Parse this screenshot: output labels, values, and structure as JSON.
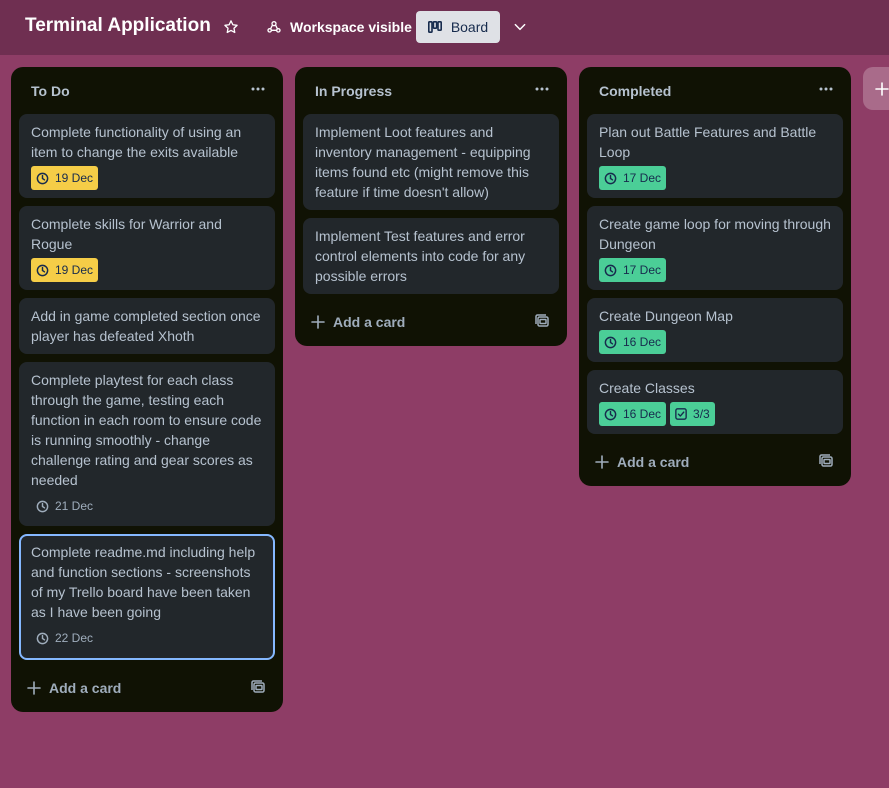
{
  "header": {
    "title": "Terminal Application",
    "visibility_label": "Workspace visible",
    "view_label": "Board"
  },
  "lists": [
    {
      "title": "To Do",
      "add_label": "Add a card",
      "cards": [
        {
          "text": "Complete functionality of using an item to change the exits available",
          "due": "19 Dec"
        },
        {
          "text": "Complete skills for Warrior and Rogue",
          "due": "19 Dec"
        },
        {
          "text": "Add in game completed section once player has defeated Xhoth"
        },
        {
          "text": "Complete playtest for each class through the game, testing each function in each room to ensure code is running smoothly - change challenge rating and gear scores as needed",
          "due": "21 Dec"
        },
        {
          "text": "Complete readme.md including help and function sections - screenshots of my Trello board have been taken as I have been going",
          "due": "22 Dec"
        }
      ]
    },
    {
      "title": "In Progress",
      "add_label": "Add a card",
      "cards": [
        {
          "text": "Implement Loot features and inventory management - equipping items found etc (might remove this feature if time doesn't allow)"
        },
        {
          "text": "Implement Test features and error control elements into code for any possible errors"
        }
      ]
    },
    {
      "title": "Completed",
      "add_label": "Add a card",
      "cards": [
        {
          "text": "Plan out Battle Features and Battle Loop",
          "due": "17 Dec"
        },
        {
          "text": "Create game loop for moving through Dungeon",
          "due": "17 Dec"
        },
        {
          "text": "Create Dungeon Map",
          "due": "16 Dec"
        },
        {
          "text": "Create Classes",
          "due": "16 Dec",
          "checklist": "3/3"
        }
      ]
    }
  ]
}
